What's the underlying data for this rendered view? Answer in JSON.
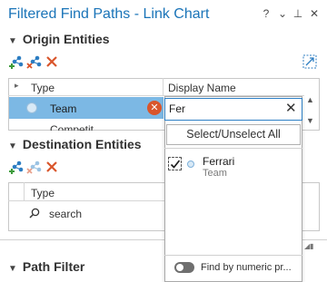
{
  "window": {
    "title": "Filtered Find Paths - Link Chart",
    "help": "?",
    "menu": "⌄",
    "pin": "⊥",
    "close": "✕"
  },
  "origin": {
    "heading": "Origin Entities",
    "col_type": "Type",
    "col_display": "Display Name",
    "row_type": "Team",
    "input_value": "Fer",
    "partial_row": "Competit"
  },
  "destination": {
    "heading": "Destination Entities",
    "col_type": "Type",
    "search_label": "search"
  },
  "dropdown": {
    "select_all": "Select/Unselect All",
    "item_name": "Ferrari",
    "item_type": "Team",
    "numeric_toggle": "Find by numeric pr..."
  },
  "path_filter": {
    "heading": "Path Filter"
  },
  "colors": {
    "title_blue": "#1a74b8",
    "selection": "#7cb8e4",
    "clear_red": "#d9552b",
    "add_green": "#3c9b3a",
    "remove_red": "#d9552b"
  }
}
